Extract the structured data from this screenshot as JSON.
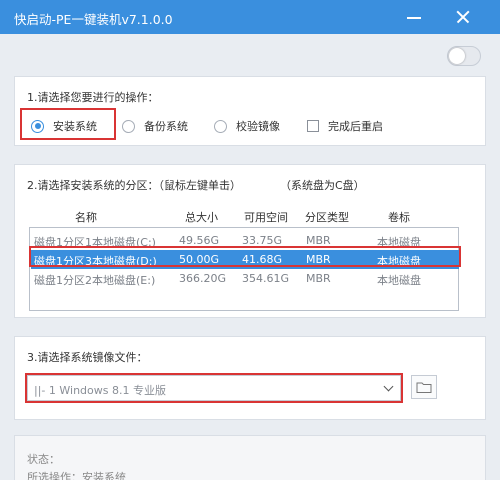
{
  "window": {
    "title": "快启动-PE一键装机v7.1.0.0"
  },
  "colors": {
    "accent": "#3a8fde",
    "highlight_border": "#d93434"
  },
  "operations": {
    "title": "1.请选择您要进行的操作：",
    "options": [
      {
        "label": "安装系统",
        "selected": true
      },
      {
        "label": "备份系统",
        "selected": false
      },
      {
        "label": "校验镜像",
        "selected": false
      }
    ],
    "reboot_label": "完成后重启",
    "reboot_checked": false
  },
  "partition": {
    "title": "2.请选择安装系统的分区：（鼠标左键单击）",
    "note": "（系统盘为C盘）",
    "columns": [
      "名称",
      "总大小",
      "可用空间",
      "分区类型",
      "卷标"
    ],
    "rows": [
      {
        "name": "磁盘1分区1本地磁盘(C:)",
        "total": "49.56G",
        "free": "33.75G",
        "type": "MBR",
        "label": "本地磁盘",
        "selected": false
      },
      {
        "name": "磁盘1分区3本地磁盘(D:)",
        "total": "50.00G",
        "free": "41.68G",
        "type": "MBR",
        "label": "本地磁盘",
        "selected": true
      },
      {
        "name": "磁盘1分区2本地磁盘(E:)",
        "total": "366.20G",
        "free": "354.61G",
        "type": "MBR",
        "label": "本地磁盘",
        "selected": false
      }
    ]
  },
  "image": {
    "title": "3.请选择系统镜像文件：",
    "selected": "||- 1 Windows  8.1 专业版"
  },
  "status": {
    "label": "状态：",
    "operation": "所选操作：安装系统"
  },
  "icons": {
    "minimize": "minimize-icon",
    "close": "close-icon",
    "folder": "folder-icon",
    "dropdown": "chevron-down-icon"
  }
}
